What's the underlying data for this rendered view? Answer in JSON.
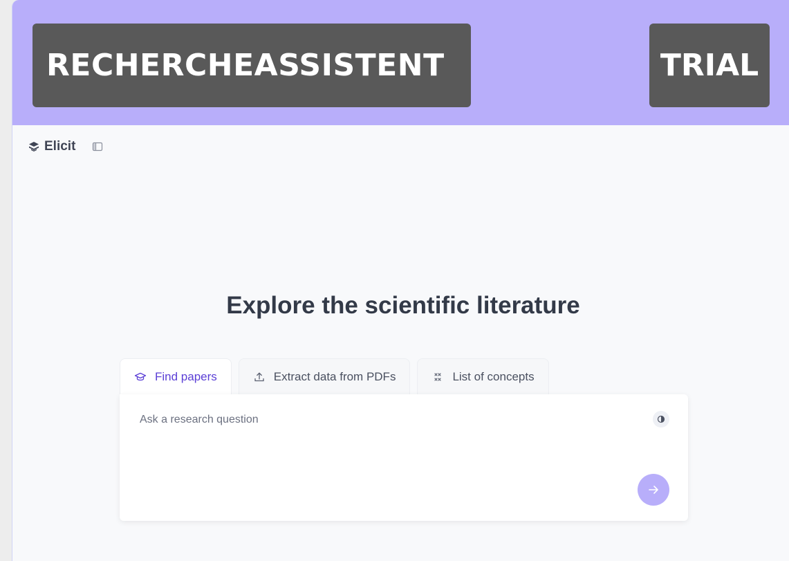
{
  "banner": {
    "title": "RECHERCHEASSISTENT",
    "badge": "TRIAL"
  },
  "brand": {
    "name": "Elicit",
    "icon": "elicit-logo-icon"
  },
  "sidebar_toggle": {
    "icon": "sidebar-toggle-icon"
  },
  "main": {
    "headline": "Explore the scientific literature",
    "tabs": [
      {
        "label": "Find papers",
        "icon": "graduation-cap-icon",
        "active": true
      },
      {
        "label": "Extract data from PDFs",
        "icon": "upload-icon",
        "active": false
      },
      {
        "label": "List of concepts",
        "icon": "concepts-icon",
        "active": false
      }
    ],
    "query": {
      "placeholder": "Ask a research question",
      "value": ""
    }
  },
  "colors": {
    "banner_bg": "#b8aefa",
    "banner_box": "#595959",
    "accent": "#5b3fd6",
    "submit_bg": "#b8aefa"
  }
}
